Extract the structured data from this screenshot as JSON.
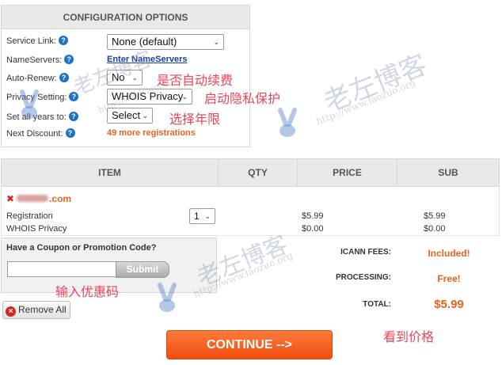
{
  "config": {
    "title": "CONFIGURATION OPTIONS",
    "help_glyph": "?",
    "rows": {
      "service_link": {
        "label": "Service Link:",
        "value": "None (default)"
      },
      "nameservers": {
        "label": "NameServers:",
        "value": "Enter NameServers"
      },
      "auto_renew": {
        "label": "Auto-Renew:",
        "value": "No"
      },
      "privacy": {
        "label": "Privacy Setting:",
        "value": "WHOIS Privacy"
      },
      "years": {
        "label": "Set all years to:",
        "value": "Select"
      },
      "discount": {
        "label": "Next Discount:",
        "value": "49 more registrations"
      }
    }
  },
  "cart": {
    "columns": [
      "ITEM",
      "QTY",
      "PRICE",
      "SUB"
    ],
    "domain_suffix": ".com",
    "remove_glyph": "✖",
    "lines": [
      {
        "item": "Registration",
        "qty": "1",
        "price": "$5.99",
        "sub": "$5.99"
      },
      {
        "item": "WHOIS Privacy",
        "qty": "",
        "price": "$0.00",
        "sub": "$0.00"
      }
    ]
  },
  "coupon": {
    "title": "Have a Coupon or Promotion Code?",
    "value": "",
    "submit_label": "Submit"
  },
  "remove_all": {
    "label": "Remove All",
    "glyph": "×"
  },
  "fees": {
    "icann_label": "ICANN FEES:",
    "icann_value": "Included!",
    "processing_label": "PROCESSING:",
    "processing_value": "Free!",
    "total_label": "TOTAL:",
    "total_value": "$5.99"
  },
  "continue_label": "CONTINUE -->",
  "annotations": {
    "auto_renew": "是否自动续费",
    "privacy": "启动隐私保护",
    "years": "选择年限",
    "coupon": "输入优惠码",
    "price": "看到价格"
  },
  "watermark": {
    "text": "老左博客",
    "url": "http://www.laozuo.org"
  },
  "colors": {
    "accent": "#e8621a",
    "link": "#1a3fa0",
    "help": "#1a73c9",
    "annotation": "#e8455a"
  }
}
